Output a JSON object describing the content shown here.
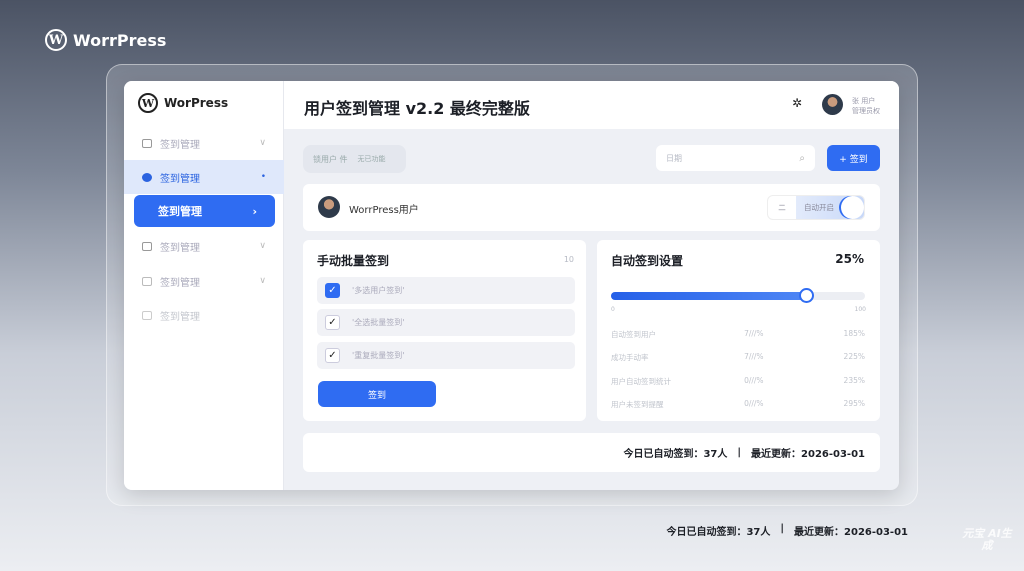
{
  "brand": {
    "name": "WorrPress"
  },
  "sidebar": {
    "logo": "WorPress",
    "items": [
      {
        "label": "签到管理",
        "icon": "login-icon"
      },
      {
        "label": "签到管理",
        "icon": "badge-icon"
      },
      {
        "label": "签到管理",
        "icon": "active-item"
      },
      {
        "label": "签到管理",
        "icon": "edit-icon"
      },
      {
        "label": "签到管理",
        "icon": "export-icon"
      },
      {
        "label": "签到管理",
        "icon": "window-icon"
      }
    ]
  },
  "header": {
    "title": "用户签到管理 v2.2 最终完整版",
    "user_line1": "张 用户",
    "user_line2": "管理员权"
  },
  "toolbar": {
    "chip_a": "锁用户 件",
    "chip_b": "无已功能",
    "search_placeholder": "日期",
    "action_label": "+ 签到"
  },
  "profile": {
    "name": "WorrPress用户",
    "toggle_left": "二",
    "toggle_right": "自动开启"
  },
  "manual": {
    "title": "手动批量签到",
    "count": "10",
    "items": [
      {
        "label": "'多选用户签到'",
        "checked": true
      },
      {
        "label": "'全选批量签到'",
        "checked": false
      },
      {
        "label": "'重复批量签到'",
        "checked": false
      }
    ],
    "submit": "签到"
  },
  "auto": {
    "title": "自动签到设置",
    "percent": "25%",
    "slider_fill_percent": 77,
    "min_label": "0",
    "max_label": "100",
    "accent": "#2f6cf2",
    "stats": [
      {
        "name": "自动签到用户",
        "mid": "7///%",
        "val": "185%"
      },
      {
        "name": "成功手动率",
        "mid": "7///%",
        "val": "225%"
      },
      {
        "name": "用户自动签到统计",
        "mid": "0///%",
        "val": "235%"
      },
      {
        "name": "用户未签到提醒",
        "mid": "0///%",
        "val": "295%"
      }
    ]
  },
  "footer": {
    "today": "今日已自动签到：37人",
    "sep": "|",
    "updated": "最近更新：2026-03-01"
  },
  "watermark": "元宝 AI生成"
}
